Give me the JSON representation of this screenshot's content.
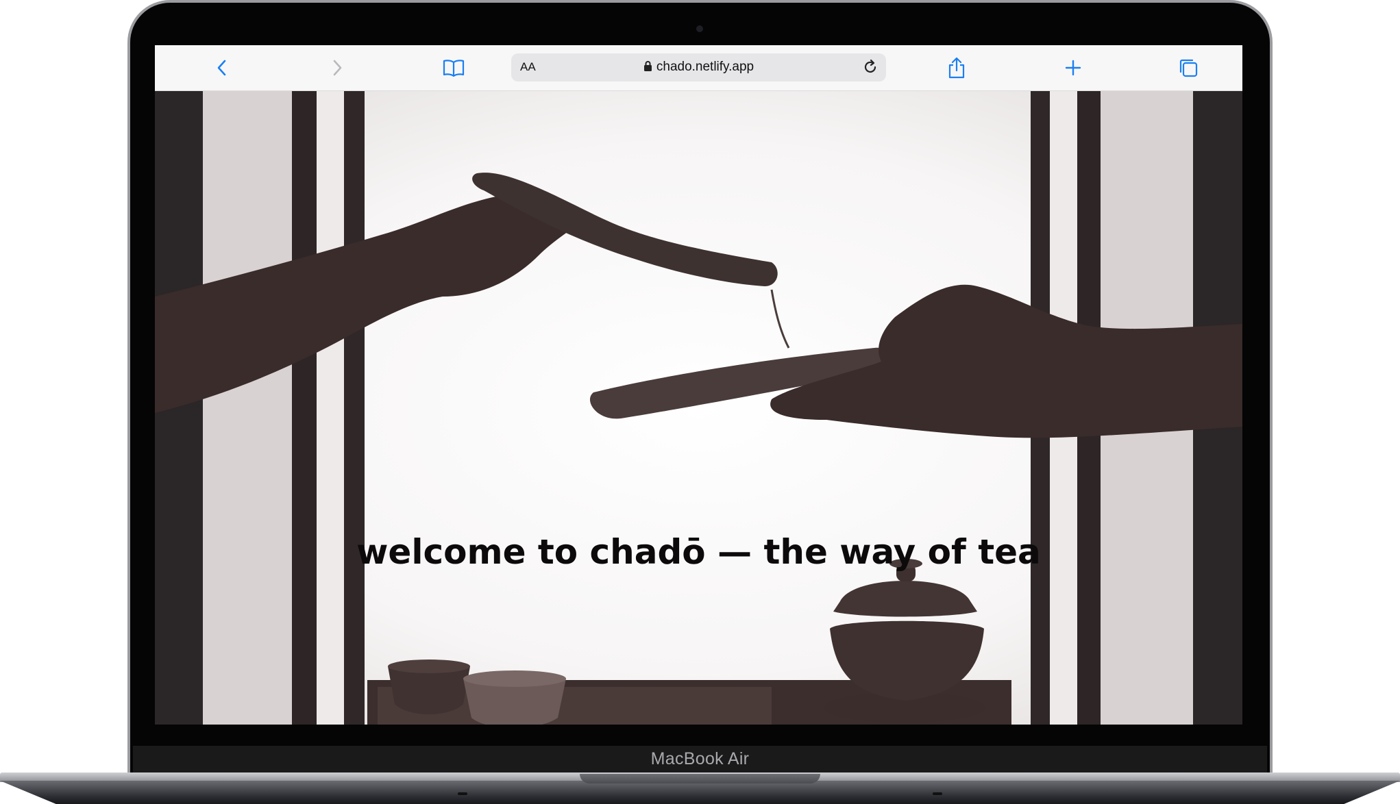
{
  "device": {
    "label": "MacBook Air"
  },
  "browser": {
    "reader_label": "AA",
    "url": "chado.netlify.app",
    "accent_color": "#1a7ff2"
  },
  "page": {
    "headline": "welcome to chadō — the way of tea"
  }
}
